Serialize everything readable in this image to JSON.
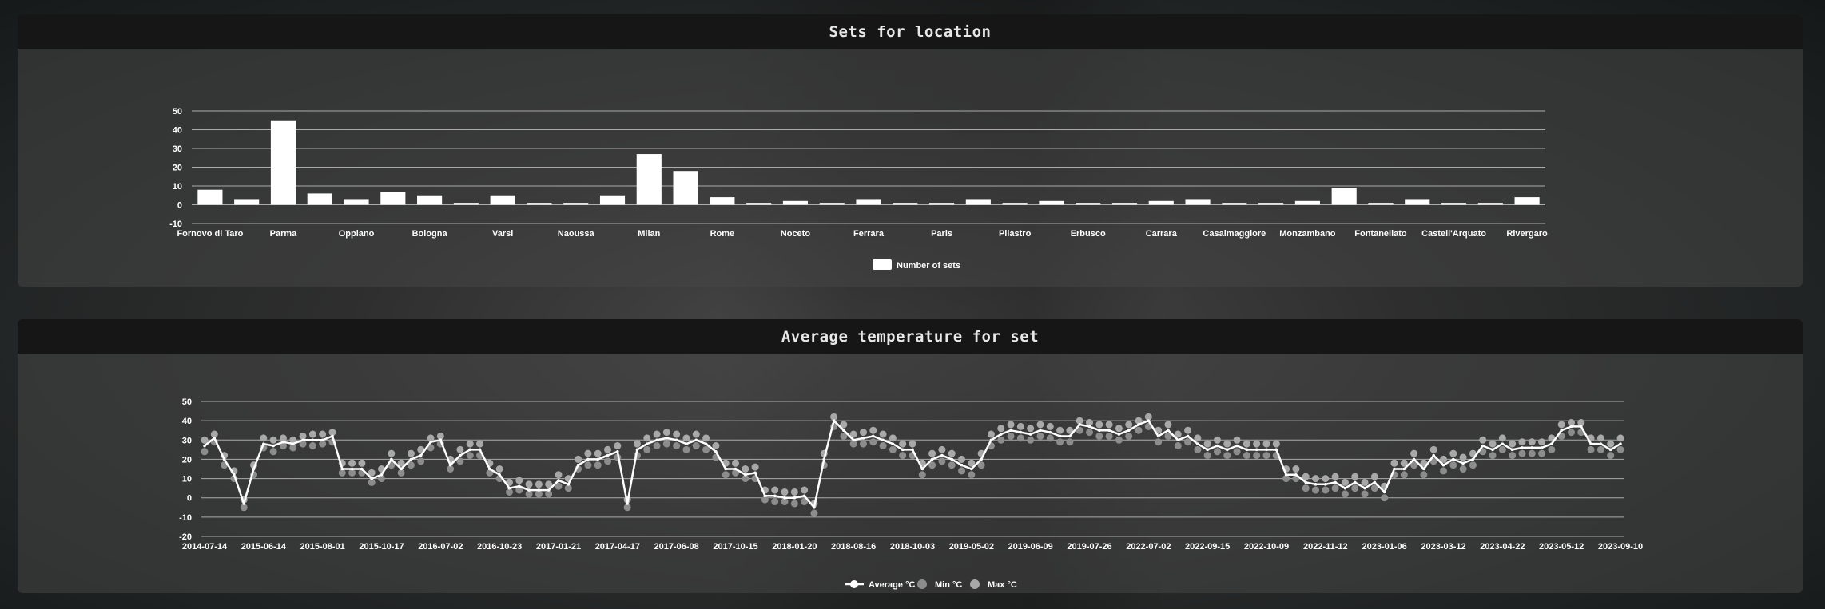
{
  "sets_panel": {
    "title": "Sets for location"
  },
  "temp_panel": {
    "title": "Average temperature for set"
  },
  "colors": {
    "bar": "#ffffff",
    "avg_line": "#ffffff",
    "min_point": "#8c8c8c",
    "max_point": "#a8a8a8",
    "grid": "#c8c8c8",
    "header_bg": "#161616"
  },
  "chart_data": [
    {
      "type": "bar",
      "title": "",
      "categories": [
        "Fornovo di Taro",
        "",
        "Parma",
        "",
        "Oppiano",
        "",
        "Bologna",
        "",
        "Varsi",
        "",
        "Naoussa",
        "",
        "Milan",
        "",
        "Rome",
        "",
        "Noceto",
        "",
        "Ferrara",
        "",
        "Paris",
        "",
        "Pilastro",
        "",
        "Erbusco",
        "",
        "Carrara",
        "",
        "Casalmaggiore",
        "",
        "Monzambano",
        "",
        "Fontanellato",
        "",
        "Castell'Arquato",
        "",
        "Rivergaro"
      ],
      "series": [
        {
          "name": "Number of sets",
          "values": [
            8,
            3,
            45,
            6,
            3,
            7,
            5,
            1,
            5,
            1,
            1,
            5,
            27,
            18,
            4,
            1,
            2,
            1,
            3,
            1,
            1,
            3,
            1,
            2,
            1,
            1,
            2,
            3,
            1,
            1,
            2,
            9,
            1,
            3,
            1,
            1,
            4
          ]
        }
      ],
      "ylim": [
        -10,
        50
      ],
      "yticks": [
        50,
        40,
        30,
        20,
        10,
        0,
        -10
      ],
      "legend_position": "bottom",
      "grid": true
    },
    {
      "type": "line",
      "title": "",
      "x_tick_labels": [
        "2014-07-14",
        "2015-06-14",
        "2015-08-01",
        "2015-10-17",
        "2016-07-02",
        "2016-10-23",
        "2017-01-21",
        "2017-04-17",
        "2017-06-08",
        "2017-10-15",
        "2018-01-20",
        "2018-08-16",
        "2018-10-03",
        "2019-05-02",
        "2019-06-09",
        "2019-07-26",
        "2022-07-02",
        "2022-09-15",
        "2022-10-09",
        "2022-11-12",
        "2023-01-06",
        "2023-03-12",
        "2023-04-22",
        "2023-05-12",
        "2023-09-10"
      ],
      "series": [
        {
          "name": "Average °C",
          "values": [
            27,
            31,
            20,
            12,
            -3,
            15,
            28,
            27,
            29,
            28,
            30,
            30,
            30,
            32,
            15,
            15,
            15,
            10,
            12,
            20,
            15,
            20,
            22,
            29,
            30,
            17,
            22,
            25,
            25,
            15,
            12,
            5,
            6,
            4,
            4,
            4,
            9,
            7,
            17,
            20,
            20,
            22,
            24,
            -3,
            25,
            28,
            30,
            31,
            30,
            28,
            30,
            28,
            24,
            15,
            15,
            12,
            13,
            1,
            1,
            0,
            0,
            1,
            -5,
            20,
            40,
            35,
            30,
            31,
            32,
            30,
            28,
            25,
            25,
            15,
            20,
            22,
            20,
            17,
            15,
            20,
            30,
            33,
            35,
            34,
            33,
            35,
            34,
            32,
            32,
            38,
            37,
            35,
            35,
            33,
            35,
            38,
            40,
            32,
            35,
            30,
            32,
            28,
            25,
            27,
            25,
            27,
            25,
            25,
            25,
            25,
            12,
            12,
            8,
            7,
            7,
            8,
            5,
            8,
            5,
            8,
            3,
            15,
            15,
            20,
            15,
            22,
            17,
            20,
            18,
            20,
            27,
            25,
            28,
            25,
            26,
            26,
            26,
            28,
            35,
            37,
            37,
            28,
            28,
            25,
            28
          ]
        },
        {
          "name": "Min °C",
          "values": [
            24,
            29,
            17,
            10,
            -5,
            12,
            26,
            24,
            27,
            26,
            28,
            27,
            28,
            29,
            13,
            13,
            13,
            8,
            10,
            17,
            13,
            17,
            19,
            26,
            28,
            15,
            19,
            22,
            22,
            13,
            10,
            3,
            4,
            2,
            2,
            2,
            6,
            5,
            15,
            17,
            17,
            19,
            21,
            -5,
            22,
            25,
            27,
            28,
            27,
            25,
            27,
            25,
            21,
            12,
            13,
            10,
            10,
            -1,
            -2,
            -2,
            -3,
            -2,
            -8,
            17,
            37,
            32,
            28,
            28,
            29,
            27,
            25,
            22,
            22,
            12,
            17,
            19,
            17,
            14,
            12,
            17,
            27,
            30,
            32,
            31,
            30,
            32,
            31,
            29,
            29,
            35,
            34,
            32,
            32,
            30,
            32,
            35,
            37,
            29,
            32,
            27,
            29,
            25,
            22,
            24,
            22,
            24,
            22,
            22,
            22,
            22,
            10,
            10,
            5,
            4,
            4,
            5,
            2,
            5,
            2,
            5,
            0,
            12,
            12,
            17,
            12,
            19,
            14,
            17,
            15,
            17,
            24,
            22,
            25,
            22,
            23,
            23,
            23,
            25,
            32,
            34,
            34,
            25,
            25,
            22,
            25
          ]
        },
        {
          "name": "Max °C",
          "values": [
            30,
            33,
            22,
            14,
            -1,
            17,
            31,
            30,
            31,
            30,
            32,
            33,
            33,
            34,
            18,
            18,
            18,
            13,
            15,
            23,
            18,
            23,
            25,
            31,
            32,
            20,
            25,
            28,
            28,
            18,
            15,
            8,
            9,
            7,
            7,
            7,
            12,
            10,
            20,
            23,
            23,
            25,
            27,
            -1,
            28,
            31,
            33,
            34,
            33,
            31,
            33,
            31,
            27,
            18,
            18,
            15,
            16,
            4,
            4,
            3,
            3,
            4,
            -3,
            23,
            42,
            38,
            33,
            34,
            35,
            33,
            31,
            28,
            28,
            18,
            23,
            25,
            23,
            20,
            18,
            23,
            33,
            36,
            38,
            37,
            36,
            38,
            37,
            35,
            35,
            40,
            39,
            38,
            38,
            36,
            38,
            40,
            42,
            35,
            38,
            33,
            35,
            31,
            28,
            30,
            28,
            30,
            28,
            28,
            28,
            28,
            15,
            15,
            11,
            10,
            10,
            11,
            8,
            11,
            8,
            11,
            6,
            18,
            18,
            23,
            18,
            25,
            20,
            23,
            21,
            23,
            30,
            28,
            31,
            28,
            29,
            29,
            29,
            31,
            38,
            39,
            39,
            31,
            31,
            28,
            31
          ]
        }
      ],
      "ylim": [
        -20,
        50
      ],
      "yticks": [
        50,
        40,
        30,
        20,
        10,
        0,
        -10,
        -20
      ],
      "legend_position": "bottom",
      "grid": true
    }
  ]
}
